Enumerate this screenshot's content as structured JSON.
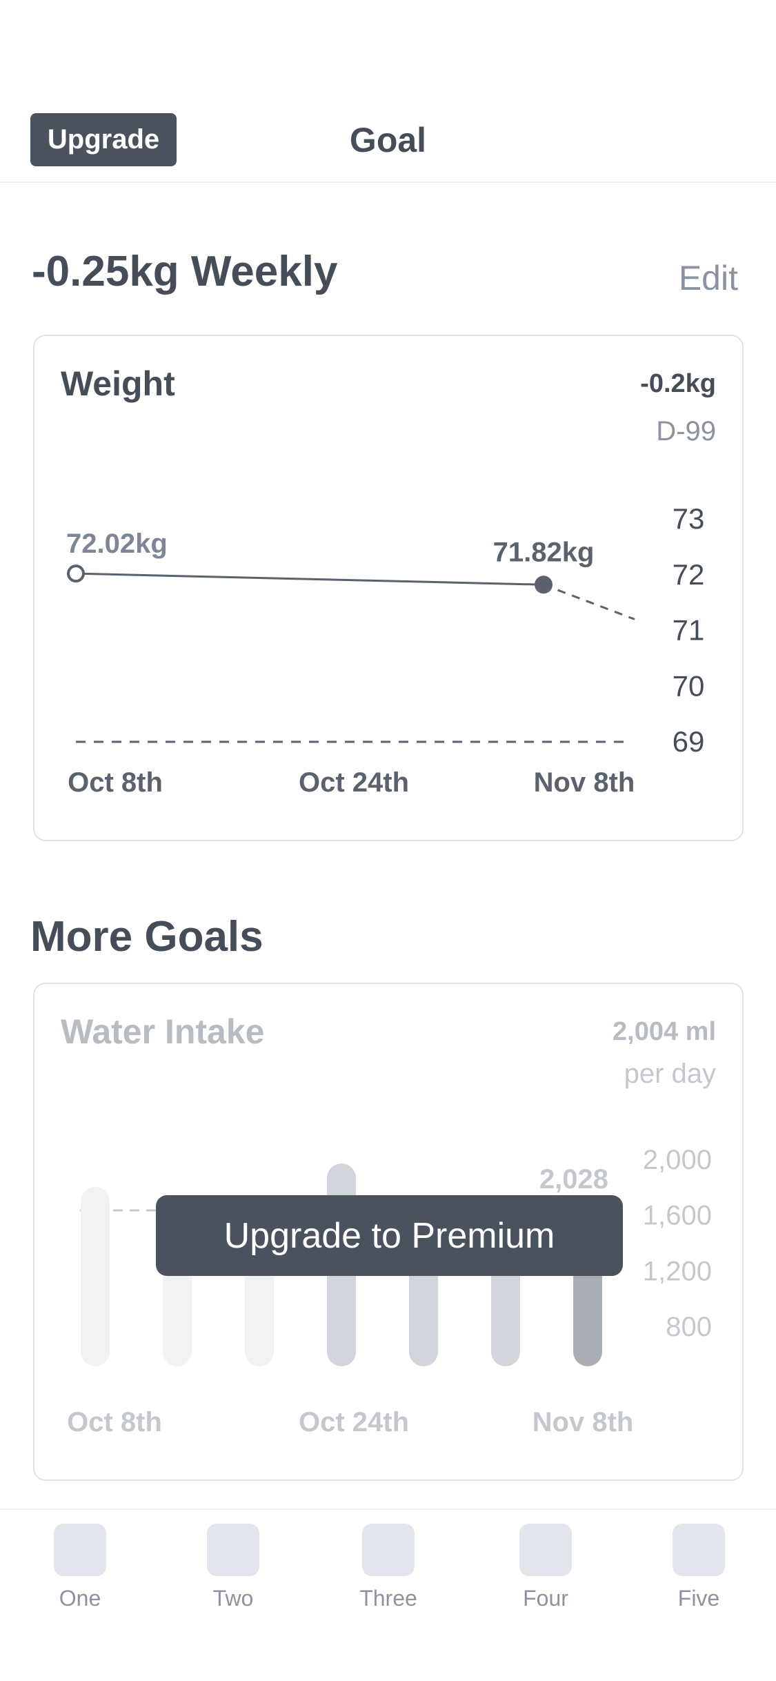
{
  "header": {
    "upgrade_label": "Upgrade",
    "title": "Goal"
  },
  "goal": {
    "heading": "-0.25kg Weekly",
    "edit_label": "Edit"
  },
  "weight_card": {
    "title": "Weight",
    "change": "-0.2kg",
    "day": "D-99",
    "start_label": "72.02kg",
    "current_label": "71.82kg"
  },
  "more_goals": {
    "heading": "More Goals"
  },
  "water_card": {
    "title": "Water Intake",
    "amount": "2,004 ml",
    "per": "per day",
    "peak_label": "2,028",
    "overlay_label": "Upgrade to Premium"
  },
  "tabs": [
    {
      "label": "One"
    },
    {
      "label": "Two"
    },
    {
      "label": "Three"
    },
    {
      "label": "Four"
    },
    {
      "label": "Five"
    }
  ],
  "colors": {
    "accent": "#4a525d",
    "text": "#454d59",
    "muted": "#8c939e",
    "border": "#dfe2e6"
  },
  "chart_data": [
    {
      "type": "line",
      "title": "Weight",
      "x_ticks": [
        "Oct 8th",
        "Oct 24th",
        "Nov 8th"
      ],
      "y_ticks": [
        73,
        72,
        71,
        70,
        69
      ],
      "ylim": [
        69,
        73
      ],
      "series": [
        {
          "points": [
            [
              "Oct 8th",
              72.02
            ],
            [
              "Nov 8th",
              71.82
            ]
          ]
        }
      ],
      "projection_end": 71.2,
      "goal_line": 69,
      "annotations": [
        "72.02kg",
        "71.82kg"
      ]
    },
    {
      "type": "bar",
      "title": "Water Intake",
      "x_ticks": [
        "Oct 8th",
        "Oct 24th",
        "Nov 8th"
      ],
      "y_ticks": [
        2000,
        1600,
        1200,
        800
      ],
      "ylim": [
        400,
        2000
      ],
      "values": [
        1800,
        1600,
        1600,
        2000,
        1600,
        1600,
        1600
      ],
      "target_line": 1620,
      "peak_label": "2,028"
    }
  ]
}
